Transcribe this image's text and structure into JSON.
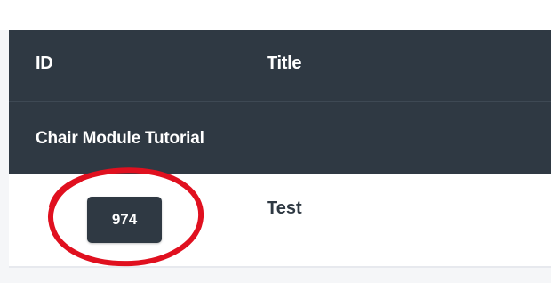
{
  "table": {
    "columns": [
      "ID",
      "Title"
    ],
    "group": {
      "label": "Chair Module Tutorial"
    },
    "rows": [
      {
        "id": "974",
        "title": "Test"
      }
    ]
  },
  "annotation": {
    "shape": "ellipse",
    "color": "#e0101f"
  },
  "colors": {
    "header_bg": "#2f3943",
    "row_bg": "#ffffff",
    "page_bg": "#f5f6f8"
  }
}
